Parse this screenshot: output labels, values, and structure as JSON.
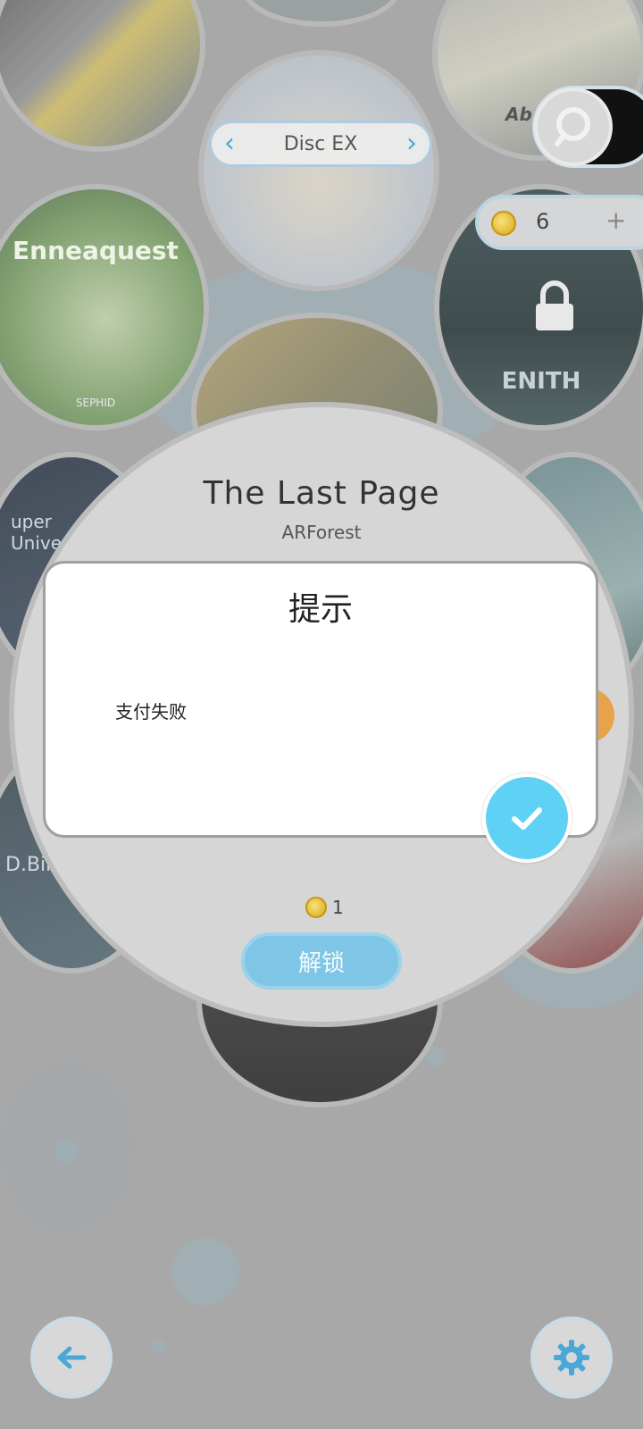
{
  "disc_selector": {
    "label": "Disc EX",
    "prev_icon": "chevron-left-icon",
    "next_icon": "chevron-right-icon"
  },
  "search": {
    "icon": "search-icon"
  },
  "wallet": {
    "coin_count": "6",
    "add_label": "+"
  },
  "albums": {
    "enneaquest": "Enneaquest",
    "sephid": "SEPHID",
    "super_universe": "uper\nUnivers",
    "zenith": "ENITH",
    "d_bin": "D.Bin",
    "ab": "Ab"
  },
  "song": {
    "title": "The Last Page",
    "artist": "ARForest"
  },
  "dialog": {
    "title": "提示",
    "message": "支付失败",
    "confirm_icon": "checkmark-icon"
  },
  "unlock": {
    "price": "1",
    "label": "解锁"
  },
  "nav": {
    "back_icon": "arrow-left-icon",
    "settings_icon": "gear-icon"
  },
  "colors": {
    "accent": "#5ed1f5",
    "unlock": "#7fc6e6",
    "coin": "#d9a818",
    "overlay": "#a8a8a8"
  }
}
